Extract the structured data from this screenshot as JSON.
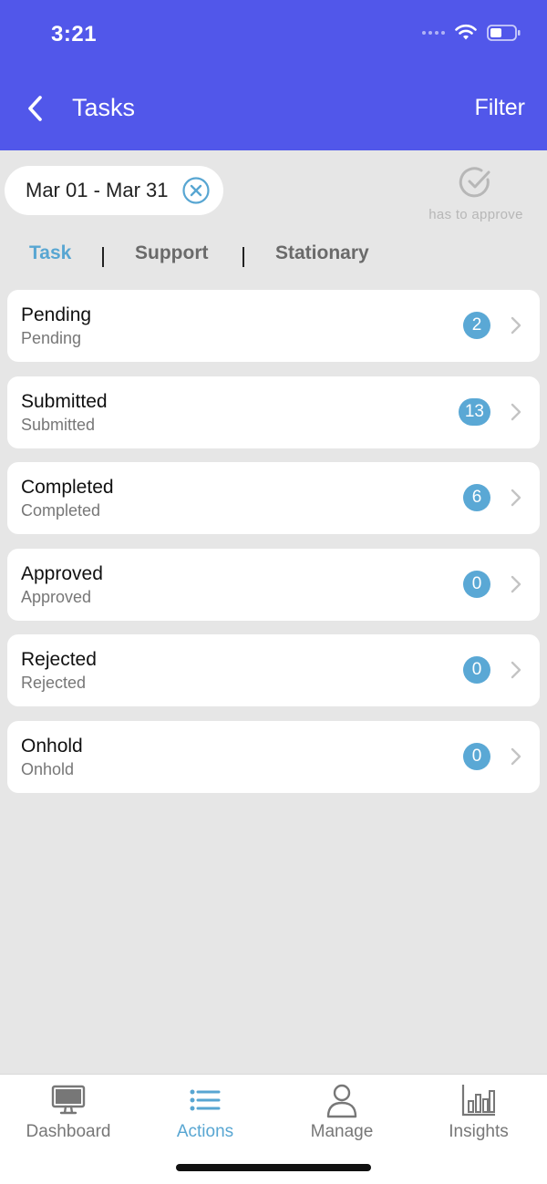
{
  "status_bar": {
    "time": "3:21"
  },
  "nav": {
    "title": "Tasks",
    "filter_label": "Filter"
  },
  "date_filter": {
    "range": "Mar 01 - Mar 31"
  },
  "approve": {
    "label": "has to approve"
  },
  "tabs": [
    {
      "label": "Task",
      "active": true
    },
    {
      "label": "Support",
      "active": false
    },
    {
      "label": "Stationary",
      "active": false
    }
  ],
  "task_rows": [
    {
      "title": "Pending",
      "subtitle": "Pending",
      "count": "2"
    },
    {
      "title": "Submitted",
      "subtitle": "Submitted",
      "count": "13"
    },
    {
      "title": "Completed",
      "subtitle": "Completed",
      "count": "6"
    },
    {
      "title": "Approved",
      "subtitle": "Approved",
      "count": "0"
    },
    {
      "title": "Rejected",
      "subtitle": "Rejected",
      "count": "0"
    },
    {
      "title": "Onhold",
      "subtitle": "Onhold",
      "count": "0"
    }
  ],
  "tabbar": [
    {
      "label": "Dashboard",
      "icon": "monitor-icon",
      "active": false
    },
    {
      "label": "Actions",
      "icon": "list-icon",
      "active": true
    },
    {
      "label": "Manage",
      "icon": "person-icon",
      "active": false
    },
    {
      "label": "Insights",
      "icon": "bar-chart-icon",
      "active": false
    }
  ],
  "colors": {
    "header": "#5157ea",
    "accent": "#58a6d2",
    "badge": "#5aa8d5",
    "background": "#e6e6e6"
  }
}
